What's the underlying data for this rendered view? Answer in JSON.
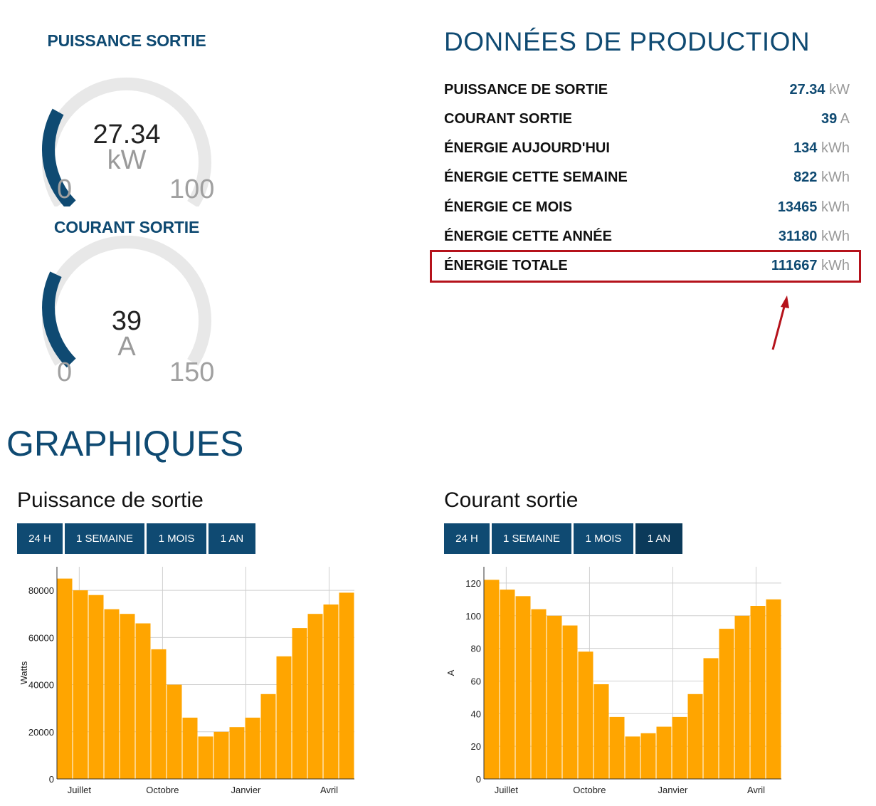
{
  "gauges": [
    {
      "title": "PUISSANCE SORTIE",
      "value": "27.34",
      "unit": "kW",
      "min": "0",
      "max": "100",
      "value_num": 27.34,
      "max_num": 100
    },
    {
      "title": "COURANT SORTIE",
      "value": "39",
      "unit": "A",
      "min": "0",
      "max": "150",
      "value_num": 39,
      "max_num": 150
    }
  ],
  "production": {
    "title": "DONNÉES DE PRODUCTION",
    "rows": [
      {
        "label": "PUISSANCE DE SORTIE",
        "value": "27.34",
        "unit": "kW"
      },
      {
        "label": "COURANT SORTIE",
        "value": "39",
        "unit": "A"
      },
      {
        "label": "ÉNERGIE AUJOURD'HUI",
        "value": "134",
        "unit": "kWh"
      },
      {
        "label": "ÉNERGIE CETTE SEMAINE",
        "value": "822",
        "unit": "kWh"
      },
      {
        "label": "ÉNERGIE CE MOIS",
        "value": "13465",
        "unit": "kWh"
      },
      {
        "label": "ÉNERGIE CETTE ANNÉE",
        "value": "31180",
        "unit": "kWh"
      },
      {
        "label": "ÉNERGIE TOTALE",
        "value": "111667",
        "unit": "kWh"
      }
    ]
  },
  "graphs_title": "GRAPHIQUES",
  "charts": [
    {
      "title": "Puissance de sortie",
      "buttons": [
        "24 H",
        "1 SEMAINE",
        "1 MOIS",
        "1 AN"
      ],
      "active": -1
    },
    {
      "title": "Courant sortie",
      "buttons": [
        "24 H",
        "1 SEMAINE",
        "1 MOIS",
        "1 AN"
      ],
      "active": 3
    }
  ],
  "colors": {
    "primary": "#0f4a72",
    "bars": "#ffa500",
    "highlight": "#b5121b",
    "track": "#e8e8e8"
  },
  "chart_data": [
    {
      "type": "bar",
      "title": "Puissance de sortie",
      "ylabel": "Watts",
      "xlabel": "",
      "ylim": [
        0,
        90000
      ],
      "yticks": [
        "0",
        "20000",
        "40000",
        "60000",
        "80000"
      ],
      "xticks": [
        "Juillet",
        "Octobre",
        "Janvier",
        "Avril"
      ],
      "series": [
        {
          "values": [
            85000,
            80000,
            78000,
            72000,
            70000,
            66000,
            55000,
            40000,
            26000,
            18000,
            20000,
            22000,
            26000,
            36000,
            52000,
            64000,
            70000,
            74000,
            79000
          ]
        }
      ]
    },
    {
      "type": "bar",
      "title": "Courant sortie",
      "ylabel": "A",
      "xlabel": "",
      "ylim": [
        0,
        130
      ],
      "yticks": [
        "0",
        "20",
        "40",
        "60",
        "80",
        "100",
        "120"
      ],
      "xticks": [
        "Juillet",
        "Octobre",
        "Janvier",
        "Avril"
      ],
      "series": [
        {
          "values": [
            122,
            116,
            112,
            104,
            100,
            94,
            78,
            58,
            38,
            26,
            28,
            32,
            38,
            52,
            74,
            92,
            100,
            106,
            110
          ]
        }
      ]
    }
  ]
}
